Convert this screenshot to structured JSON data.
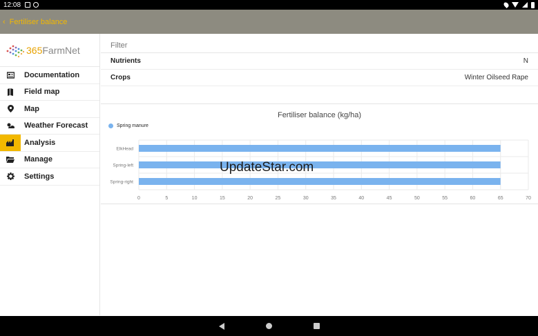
{
  "status": {
    "time": "12:08"
  },
  "appbar": {
    "back": "‹",
    "title": "Fertiliser balance"
  },
  "logo": {
    "text_prefix": "365",
    "text_suffix": "FarmNet"
  },
  "sidebar": {
    "items": [
      {
        "label": "Documentation",
        "icon": "documentation-icon"
      },
      {
        "label": "Field map",
        "icon": "field-map-icon"
      },
      {
        "label": "Map",
        "icon": "map-pin-icon"
      },
      {
        "label": "Weather Forecast",
        "icon": "weather-icon"
      },
      {
        "label": "Analysis",
        "icon": "analysis-icon",
        "active": true
      },
      {
        "label": "Manage",
        "icon": "folder-icon"
      },
      {
        "label": "Settings",
        "icon": "gear-icon"
      }
    ]
  },
  "filter": {
    "heading": "Filter",
    "rows": [
      {
        "key": "Nutrients",
        "value": "N"
      },
      {
        "key": "Crops",
        "value": "Winter Oilseed Rape"
      }
    ]
  },
  "chart_data": {
    "type": "bar",
    "orientation": "horizontal",
    "title": "Fertiliser balance (kg/ha)",
    "categories": [
      "ElkHead",
      "Spring-left",
      "Spring-right"
    ],
    "series": [
      {
        "name": "Spring manure",
        "values": [
          65,
          65,
          65
        ],
        "color": "#7ab3ee"
      }
    ],
    "xlim": [
      0,
      70
    ],
    "xticks": [
      0,
      5,
      10,
      15,
      20,
      25,
      30,
      35,
      40,
      45,
      50,
      55,
      60,
      65,
      70
    ],
    "grid": true,
    "legend": "top-left"
  },
  "watermark": "UpdateStar.com"
}
